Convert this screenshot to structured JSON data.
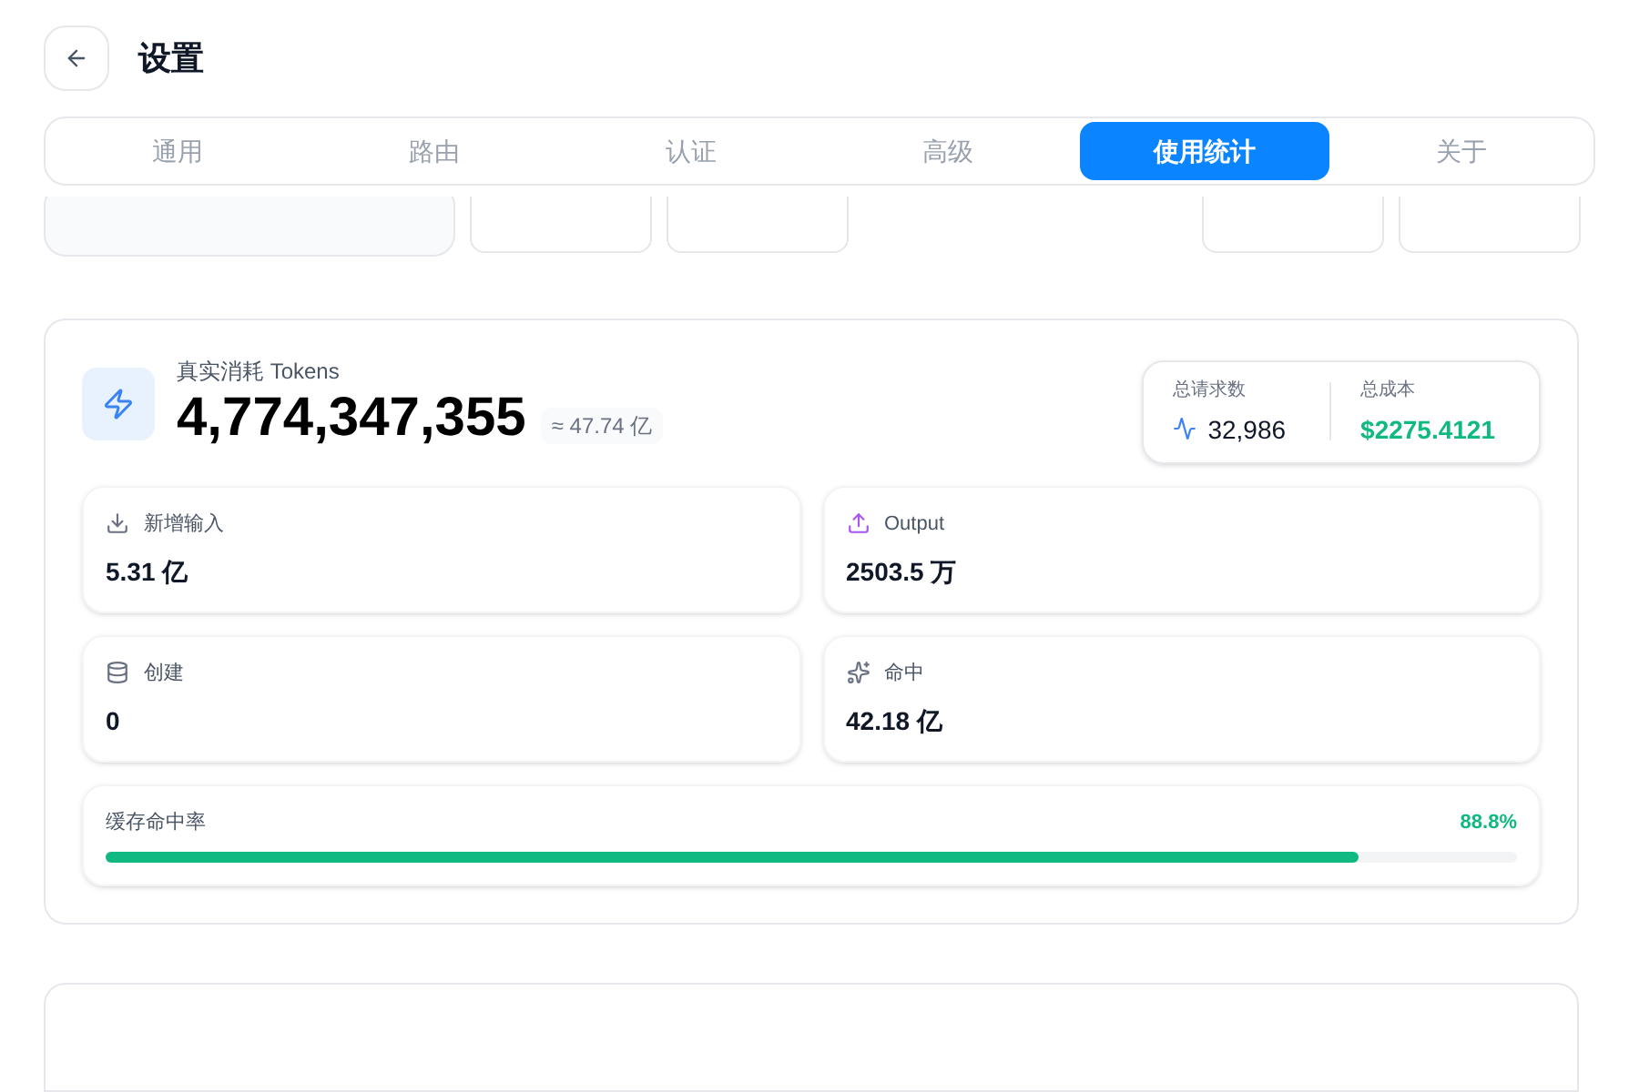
{
  "header": {
    "title": "设置"
  },
  "tabs": [
    {
      "label": "通用",
      "selected": false
    },
    {
      "label": "路由",
      "selected": false
    },
    {
      "label": "认证",
      "selected": false
    },
    {
      "label": "高级",
      "selected": false
    },
    {
      "label": "使用统计",
      "selected": true
    },
    {
      "label": "关于",
      "selected": false
    }
  ],
  "summary": {
    "label": "真实消耗 Tokens",
    "value": "4,774,347,355",
    "approx": "≈ 47.74 亿",
    "stats": [
      {
        "kind": "requests",
        "label": "总请求数",
        "value": "32,986"
      },
      {
        "kind": "cost",
        "label": "总成本",
        "value": "$2275.4121"
      }
    ]
  },
  "metrics": [
    {
      "kind": "input",
      "label": "新增输入",
      "value": "5.31 亿"
    },
    {
      "kind": "output",
      "label": "Output",
      "value": "2503.5 万"
    },
    {
      "kind": "create",
      "label": "创建",
      "value": "0"
    },
    {
      "kind": "hit",
      "label": "命中",
      "value": "42.18 亿"
    }
  ],
  "cache_rate": {
    "label": "缓存命中率",
    "reading": "88.8%",
    "level": 0.888
  }
}
